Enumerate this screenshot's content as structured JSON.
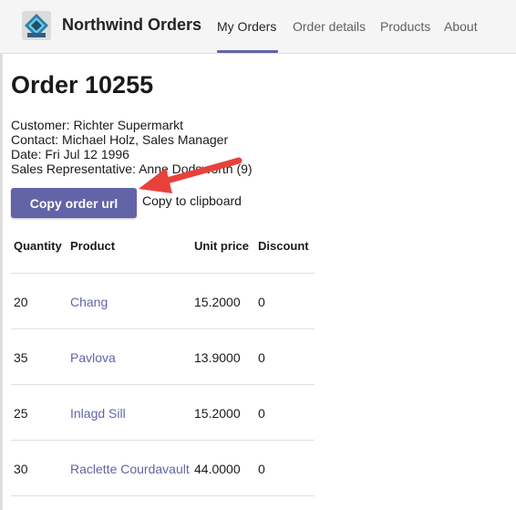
{
  "header": {
    "app_title": "Northwind Orders",
    "tabs": [
      {
        "label": "My Orders",
        "active": true
      },
      {
        "label": "Order details",
        "active": false
      },
      {
        "label": "Products",
        "active": false
      },
      {
        "label": "About",
        "active": false
      }
    ]
  },
  "order": {
    "title": "Order 10255",
    "customer": "Customer: Richter Supermarkt",
    "contact": "Contact: Michael Holz, Sales Manager",
    "date": "Date: Fri Jul 12 1996",
    "sales_rep": "Sales Representative: Anne Dodsworth (9)"
  },
  "actions": {
    "copy_button": "Copy order url",
    "clipboard_text": "Copy to clipboard"
  },
  "table": {
    "headers": [
      "Quantity",
      "Product",
      "Unit price",
      "Discount"
    ],
    "rows": [
      {
        "quantity": "20",
        "product": "Chang",
        "unit_price": "15.2000",
        "discount": "0"
      },
      {
        "quantity": "35",
        "product": "Pavlova",
        "unit_price": "13.9000",
        "discount": "0"
      },
      {
        "quantity": "25",
        "product": "Inlagd Sill",
        "unit_price": "15.2000",
        "discount": "0"
      },
      {
        "quantity": "30",
        "product": "Raclette Courdavault",
        "unit_price": "44.0000",
        "discount": "0"
      }
    ]
  },
  "colors": {
    "accent": "#6264a7",
    "annotation_arrow": "#e8413c"
  },
  "icons": {
    "logo": "northwind-logo-icon",
    "annotation": "red-arrow-icon"
  }
}
